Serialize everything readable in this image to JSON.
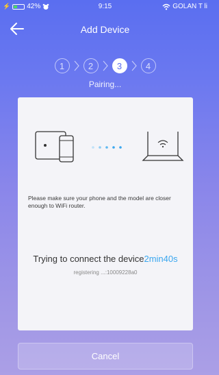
{
  "status_bar": {
    "battery": "42%",
    "time": "9:15",
    "carrier": "GOLAN T li",
    "battery_level": 0.42
  },
  "nav": {
    "title": "Add Device",
    "back_icon": "back-arrow-icon"
  },
  "steps": {
    "items": [
      "1",
      "2",
      "3",
      "4"
    ],
    "active_index": 2,
    "label": "Pairing..."
  },
  "card": {
    "hint": "Please make sure your phone and the model are closer enough to WiFi router.",
    "trying_text": "Trying to connect the device",
    "countdown": "2min40s",
    "registering": "registering ...:10009228a0"
  },
  "buttons": {
    "cancel": "Cancel"
  },
  "colors": {
    "accent": "#3aa7ef",
    "gradient_top": "#5a6ef0",
    "gradient_bottom": "#ab9fe6"
  }
}
